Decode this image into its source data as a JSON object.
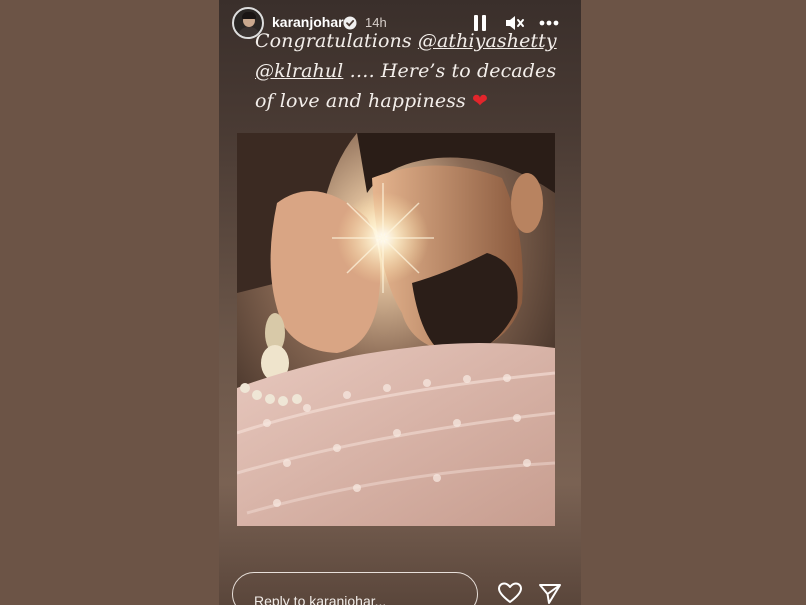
{
  "header": {
    "username": "karanjohar",
    "time": "14h"
  },
  "caption": {
    "line1_prefix": "Congratulations ",
    "mention1": "@athiyashetty",
    "mention2": "@klrahul",
    "line2_rest": " …. Here’s to decades",
    "line3": "of love and happiness ",
    "emoji": "❤"
  },
  "reply": {
    "placeholder": "Reply to karanjohar..."
  },
  "icons": {
    "avatar": "avatar",
    "verified": "verified-badge-icon",
    "pause": "pause-icon",
    "mute": "mute-icon",
    "more": "more-icon",
    "like": "heart-icon",
    "share": "send-icon"
  },
  "colors": {
    "page_background": "#6c5446",
    "verified": "#3897f0",
    "heart_emoji": "#e2252b"
  }
}
